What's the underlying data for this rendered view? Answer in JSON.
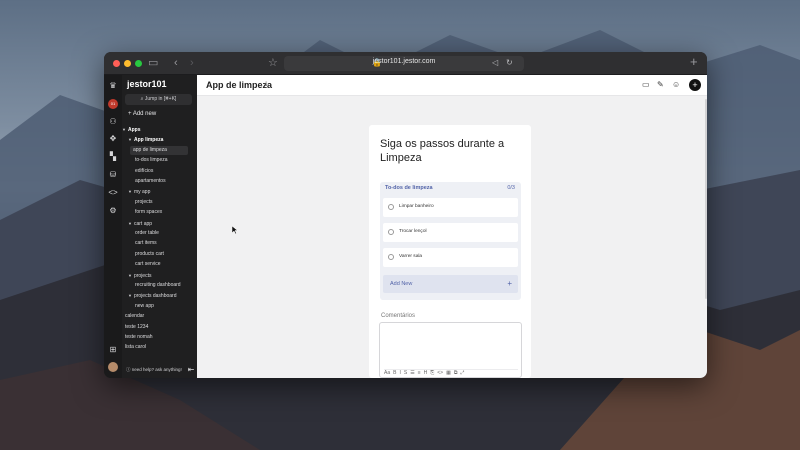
{
  "browser": {
    "url": "jestor101.jestor.com"
  },
  "sidebar": {
    "workspace_name": "jestor101",
    "jump_label": "Jump in [⌘+K]",
    "add_new": "+ Add new",
    "avatar_text": "01",
    "help_text": "need help? ask anything!",
    "items": [
      {
        "label": "Apps",
        "level": 0,
        "caret": true,
        "bold": true
      },
      {
        "label": "App limpeza",
        "level": 1,
        "caret": true,
        "bold": true
      },
      {
        "label": "app de limpeza",
        "level": 2,
        "selected": true
      },
      {
        "label": "to-dos limpeza",
        "level": 2
      },
      {
        "label": "edifícios",
        "level": 2
      },
      {
        "label": "apartamentos",
        "level": 2
      },
      {
        "label": "my app",
        "level": 1,
        "caret": true
      },
      {
        "label": "projects",
        "level": 2
      },
      {
        "label": "form spacex",
        "level": 2
      },
      {
        "label": "cart app",
        "level": 1,
        "caret": true
      },
      {
        "label": "order table",
        "level": 2
      },
      {
        "label": "cart items",
        "level": 2
      },
      {
        "label": "products cart",
        "level": 2
      },
      {
        "label": "cart service",
        "level": 2
      },
      {
        "label": "projects",
        "level": 1,
        "caret": true
      },
      {
        "label": "recruiting dashboard",
        "level": 2
      },
      {
        "label": "projects dashboard",
        "level": 1,
        "caret": true
      },
      {
        "label": "new app",
        "level": 2
      },
      {
        "label": "calendar",
        "level": 0
      },
      {
        "label": "teste 1234",
        "level": 0
      },
      {
        "label": "teste nomah",
        "level": 0
      },
      {
        "label": "lista carol",
        "level": 0
      }
    ]
  },
  "main": {
    "page_title": "App de limpeza",
    "card": {
      "title": "Siga os passos durante a Limpeza",
      "todo": {
        "name": "To-dos de limpeza",
        "count": "0/3",
        "tasks": [
          "Limpar banheiro",
          "Trocar lençol",
          "Varrer sala"
        ],
        "add_new": "Add New"
      },
      "comments_label": "Comentários",
      "toolbar_items": [
        "Aa",
        "B",
        "I",
        "S",
        "☰",
        "≡",
        "H",
        "⎘",
        "<>",
        "▦",
        "⧉",
        "⤢"
      ]
    }
  },
  "icons": {
    "sidebar_rail": [
      "jestor-logo-icon",
      "avatar",
      "add-user-icon",
      "integrations-icon",
      "dashboard-icon",
      "database-icon",
      "code-icon",
      "settings-icon",
      "apps-grid-icon",
      "user-avatar"
    ],
    "header": [
      "desktop-icon",
      "pen-icon",
      "user-icon",
      "plus-icon"
    ]
  }
}
